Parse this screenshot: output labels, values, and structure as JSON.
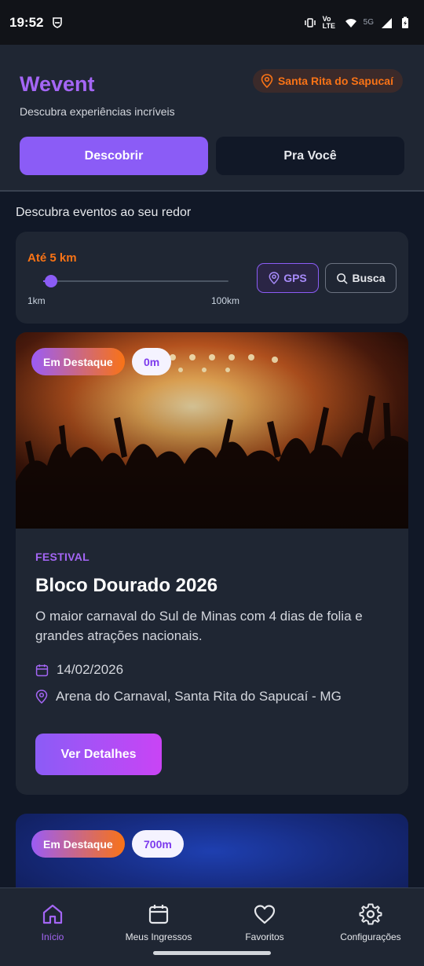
{
  "status_bar": {
    "time": "19:52",
    "network_label": "5G",
    "volte_label": "Vo LTE"
  },
  "header": {
    "brand": "Wevent",
    "tagline": "Descubra experiências incríveis",
    "location": "Santa Rita do Sapucaí",
    "tabs": [
      {
        "label": "Descobrir",
        "active": true
      },
      {
        "label": "Pra Você",
        "active": false
      }
    ]
  },
  "main": {
    "section_title": "Descubra eventos ao seu redor",
    "distance": {
      "label": "Até 5 km",
      "min_label": "1km",
      "max_label": "100km",
      "value_km": 5,
      "min_km": 1,
      "max_km": 100,
      "gps_label": "GPS",
      "search_label": "Busca"
    },
    "events": [
      {
        "badge": "Em Destaque",
        "distance": "0m",
        "category": "FESTIVAL",
        "title": "Bloco Dourado 2026",
        "description": "O maior carnaval do Sul de Minas com 4 dias de folia e grandes atrações nacionais.",
        "date": "14/02/2026",
        "place": "Arena do Carnaval, Santa Rita do Sapucaí - MG",
        "button": "Ver Detalhes"
      },
      {
        "badge": "Em Destaque",
        "distance": "700m"
      }
    ]
  },
  "bottom_nav": {
    "items": [
      {
        "label": "Início",
        "icon": "home-icon",
        "active": true
      },
      {
        "label": "Meus Ingressos",
        "icon": "calendar-icon",
        "active": false
      },
      {
        "label": "Favoritos",
        "icon": "heart-icon",
        "active": false
      },
      {
        "label": "Configurações",
        "icon": "gear-icon",
        "active": false
      }
    ]
  },
  "colors": {
    "accent": "#8b5cf6",
    "orange": "#f97316",
    "background": "#111827",
    "card": "#1f2633"
  }
}
